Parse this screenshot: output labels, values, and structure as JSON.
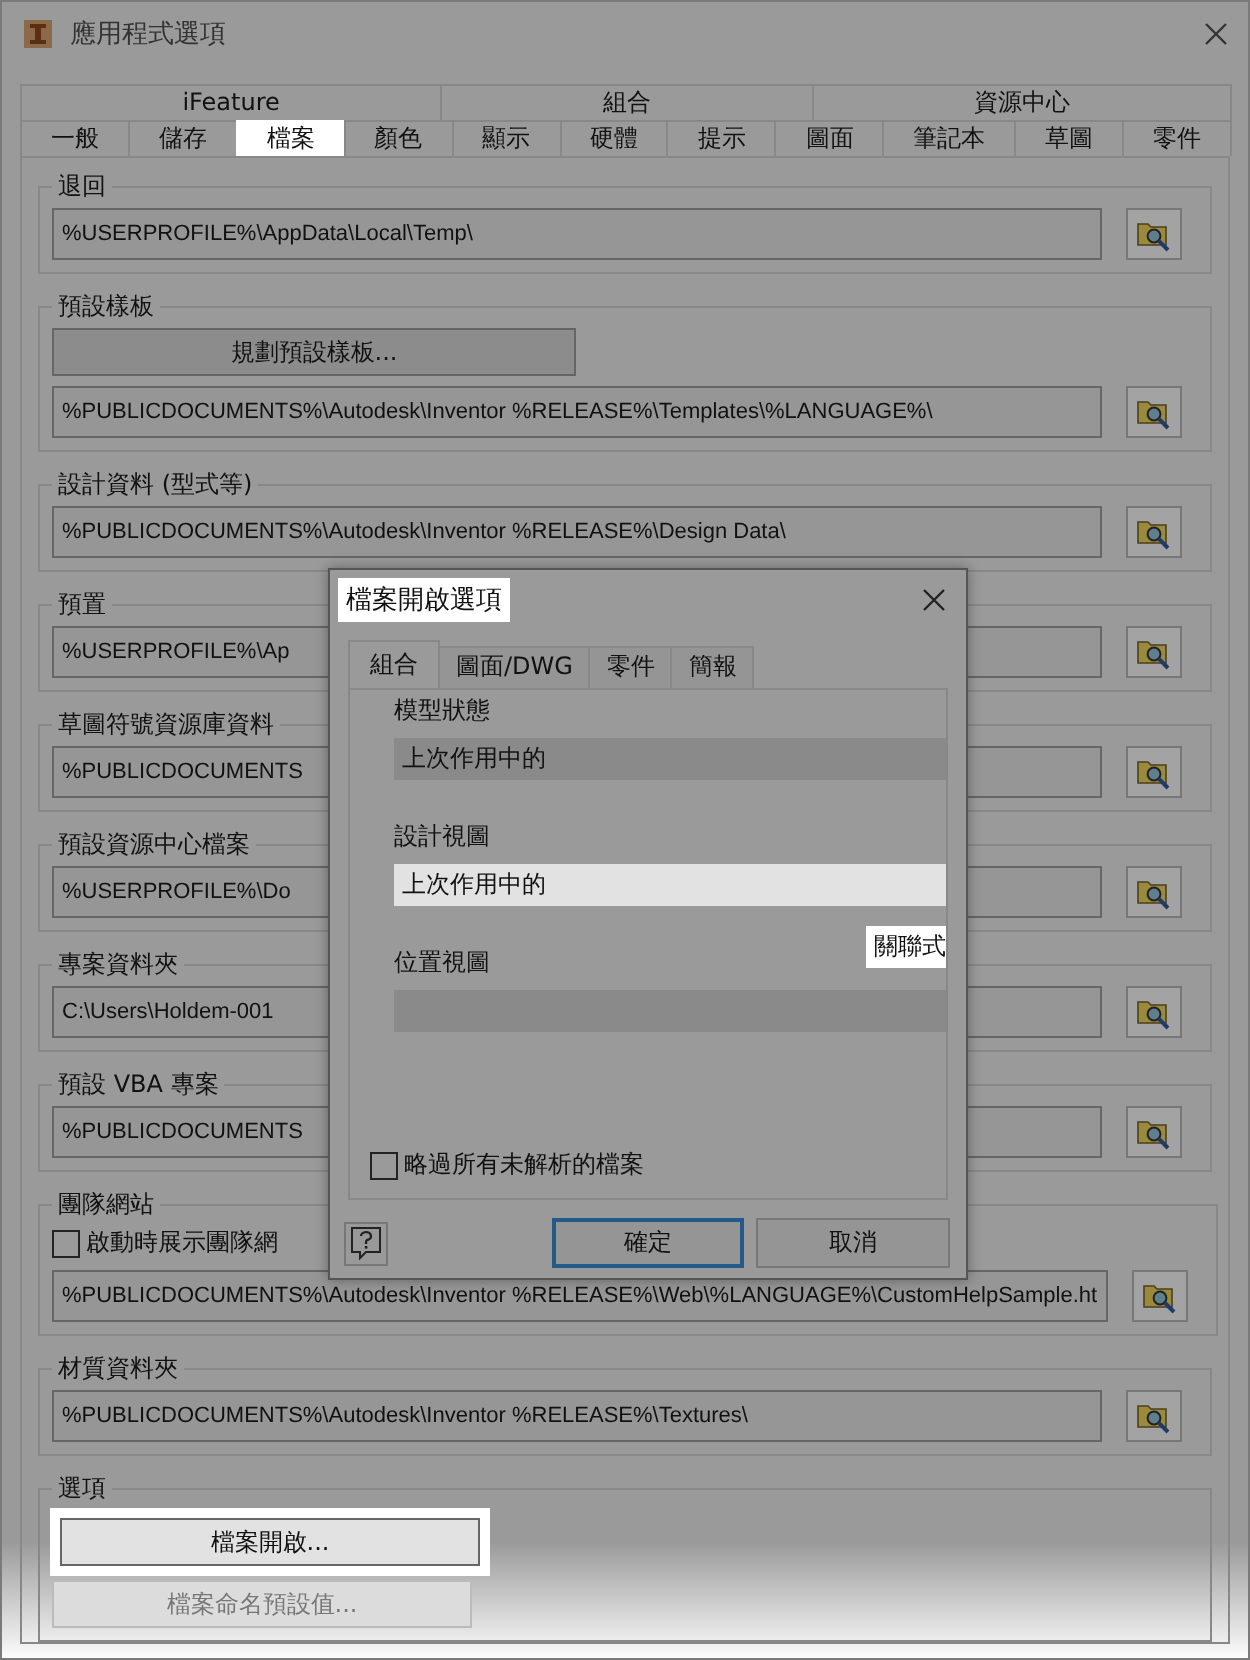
{
  "window": {
    "title": "應用程式選項"
  },
  "tab_rows": [
    [
      {
        "label": "iFeature",
        "selected": false
      },
      {
        "label": "組合",
        "selected": false
      },
      {
        "label": "資源中心",
        "selected": false
      }
    ],
    [
      {
        "label": "一般",
        "selected": false
      },
      {
        "label": "儲存",
        "selected": false
      },
      {
        "label": "檔案",
        "selected": true
      },
      {
        "label": "顏色",
        "selected": false
      },
      {
        "label": "顯示",
        "selected": false
      },
      {
        "label": "硬體",
        "selected": false
      },
      {
        "label": "提示",
        "selected": false
      },
      {
        "label": "圖面",
        "selected": false
      },
      {
        "label": "筆記本",
        "selected": false
      },
      {
        "label": "草圖",
        "selected": false
      },
      {
        "label": "零件",
        "selected": false
      }
    ]
  ],
  "sections": [
    {
      "legend": "退回",
      "items": [
        {
          "kind": "path",
          "value": "%USERPROFILE%\\AppData\\Local\\Temp\\"
        }
      ]
    },
    {
      "legend": "預設樣板",
      "items": [
        {
          "kind": "button",
          "label": "規劃預設樣板...",
          "disabled": false,
          "highlighted": false
        },
        {
          "kind": "path",
          "value": "%PUBLICDOCUMENTS%\\Autodesk\\Inventor %RELEASE%\\Templates\\%LANGUAGE%\\"
        }
      ]
    },
    {
      "legend": "設計資料 (型式等)",
      "items": [
        {
          "kind": "path",
          "value": "%PUBLICDOCUMENTS%\\Autodesk\\Inventor %RELEASE%\\Design Data\\"
        }
      ]
    },
    {
      "legend": "預置",
      "items": [
        {
          "kind": "path",
          "value": "%USERPROFILE%\\Ap"
        }
      ]
    },
    {
      "legend": "草圖符號資源庫資料",
      "items": [
        {
          "kind": "path",
          "value": "%PUBLICDOCUMENTS"
        }
      ]
    },
    {
      "legend": "預設資源中心檔案",
      "items": [
        {
          "kind": "path",
          "value": "%USERPROFILE%\\Do"
        }
      ]
    },
    {
      "legend": "專案資料夾",
      "items": [
        {
          "kind": "path",
          "value": "C:\\Users\\Holdem-001"
        }
      ]
    },
    {
      "legend": "預設 VBA 專案",
      "items": [
        {
          "kind": "path",
          "value": "%PUBLICDOCUMENTS"
        }
      ]
    },
    {
      "legend": "團隊網站",
      "items": [
        {
          "kind": "checkbox",
          "label": "啟動時展示團隊網",
          "checked": false
        },
        {
          "kind": "path",
          "value": "%PUBLICDOCUMENTS%\\Autodesk\\Inventor %RELEASE%\\Web\\%LANGUAGE%\\CustomHelpSample.ht"
        }
      ]
    },
    {
      "legend": "材質資料夾",
      "items": [
        {
          "kind": "path",
          "value": "%PUBLICDOCUMENTS%\\Autodesk\\Inventor %RELEASE%\\Textures\\"
        }
      ]
    },
    {
      "legend": "選項",
      "items": [
        {
          "kind": "button",
          "label": "檔案開啟...",
          "disabled": false,
          "highlighted": true
        },
        {
          "kind": "button",
          "label": "檔案命名預設值...",
          "disabled": true,
          "highlighted": false
        }
      ]
    }
  ],
  "dialog": {
    "title": "檔案開啟選項",
    "title_highlighted": true,
    "tabs": [
      {
        "label": "組合",
        "selected": true
      },
      {
        "label": "圖面/DWG",
        "selected": false
      },
      {
        "label": "零件",
        "selected": false
      },
      {
        "label": "簡報",
        "selected": false
      }
    ],
    "fields": [
      {
        "label": "模型狀態",
        "value": "上次作用中的",
        "highlighted": false
      },
      {
        "label": "設計視圖",
        "value": "上次作用中的",
        "highlighted": true
      },
      {
        "label": "位置視圖",
        "highlighted": false
      }
    ],
    "callout": {
      "text": "關聯式",
      "highlighted": true
    },
    "checkbox": {
      "label": "略過所有未解析的檔案",
      "checked": false
    },
    "buttons": [
      {
        "label": "確定",
        "default": true
      },
      {
        "label": "取消",
        "default": false
      }
    ]
  }
}
